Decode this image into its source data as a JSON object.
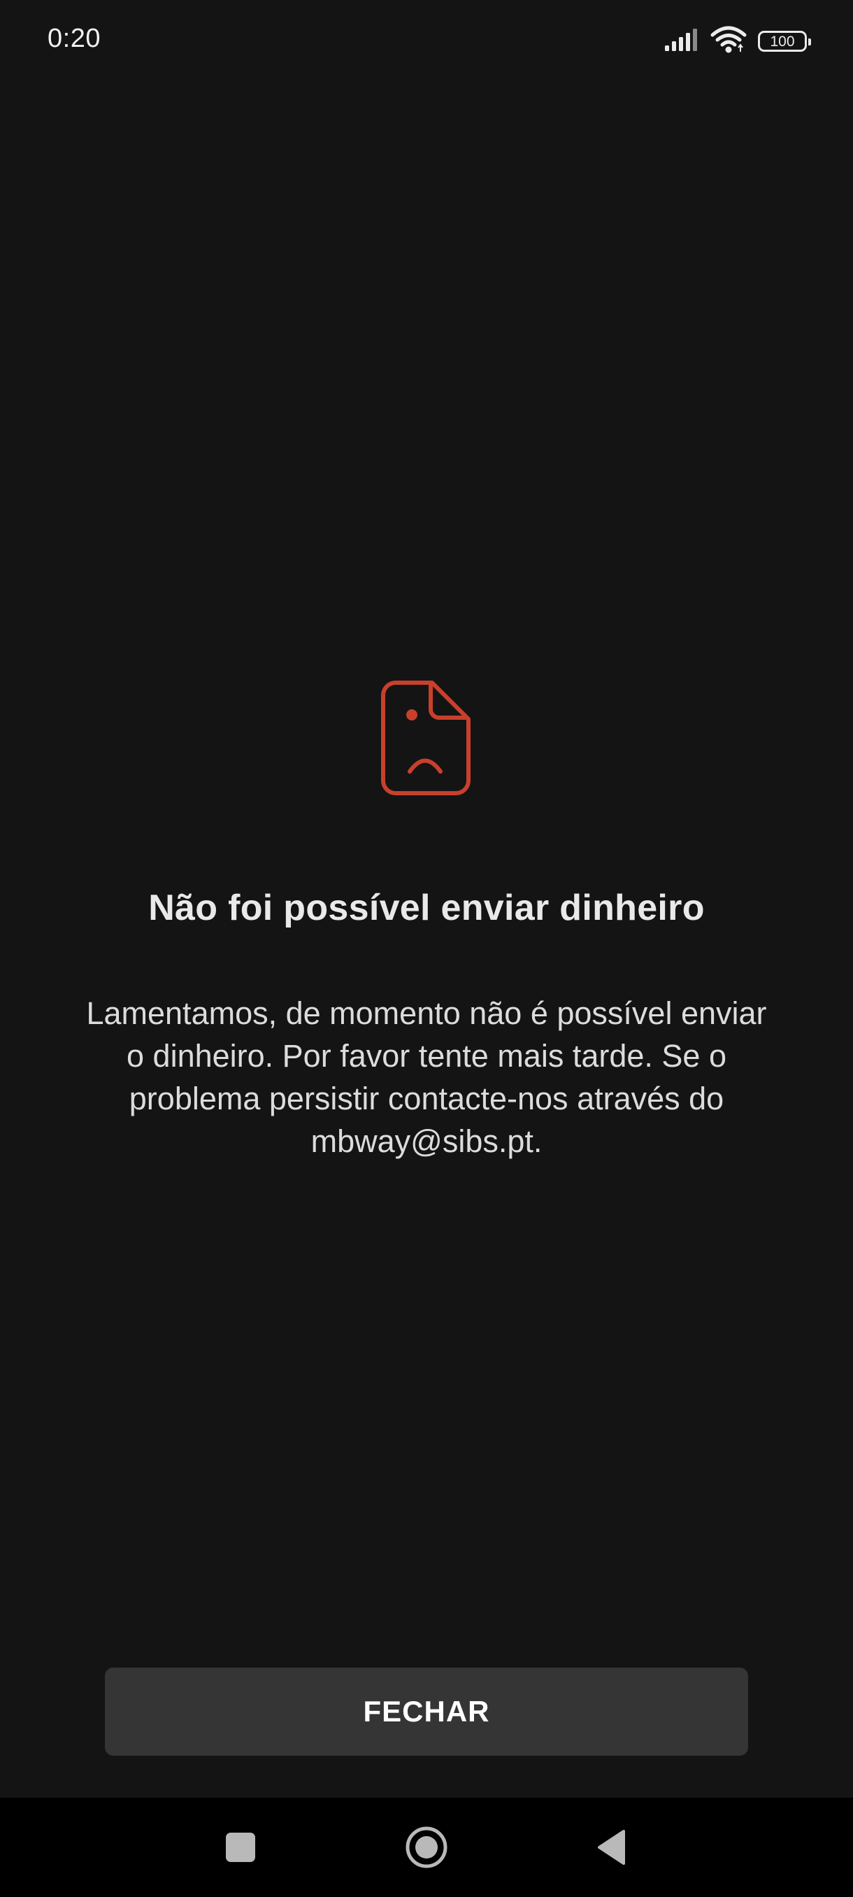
{
  "status_bar": {
    "time": "0:20",
    "battery": "100",
    "icons": [
      "signal-icon",
      "wifi-icon",
      "battery-icon"
    ]
  },
  "error": {
    "icon": "sad-document-icon",
    "icon_color": "#c8402c",
    "title": "Não foi possível enviar dinheiro",
    "message": "Lamentamos, de momento não é possível enviar o dinheiro. Por favor tente mais tarde. Se o problema persistir contacte-nos através do mbway@sibs.pt."
  },
  "actions": {
    "close_label": "FECHAR"
  },
  "nav_bar": {
    "icons": [
      "recents-square-icon",
      "home-circle-icon",
      "back-triangle-icon"
    ]
  },
  "colors": {
    "background": "#141414",
    "button": "#353535",
    "nav_background": "#000000"
  }
}
